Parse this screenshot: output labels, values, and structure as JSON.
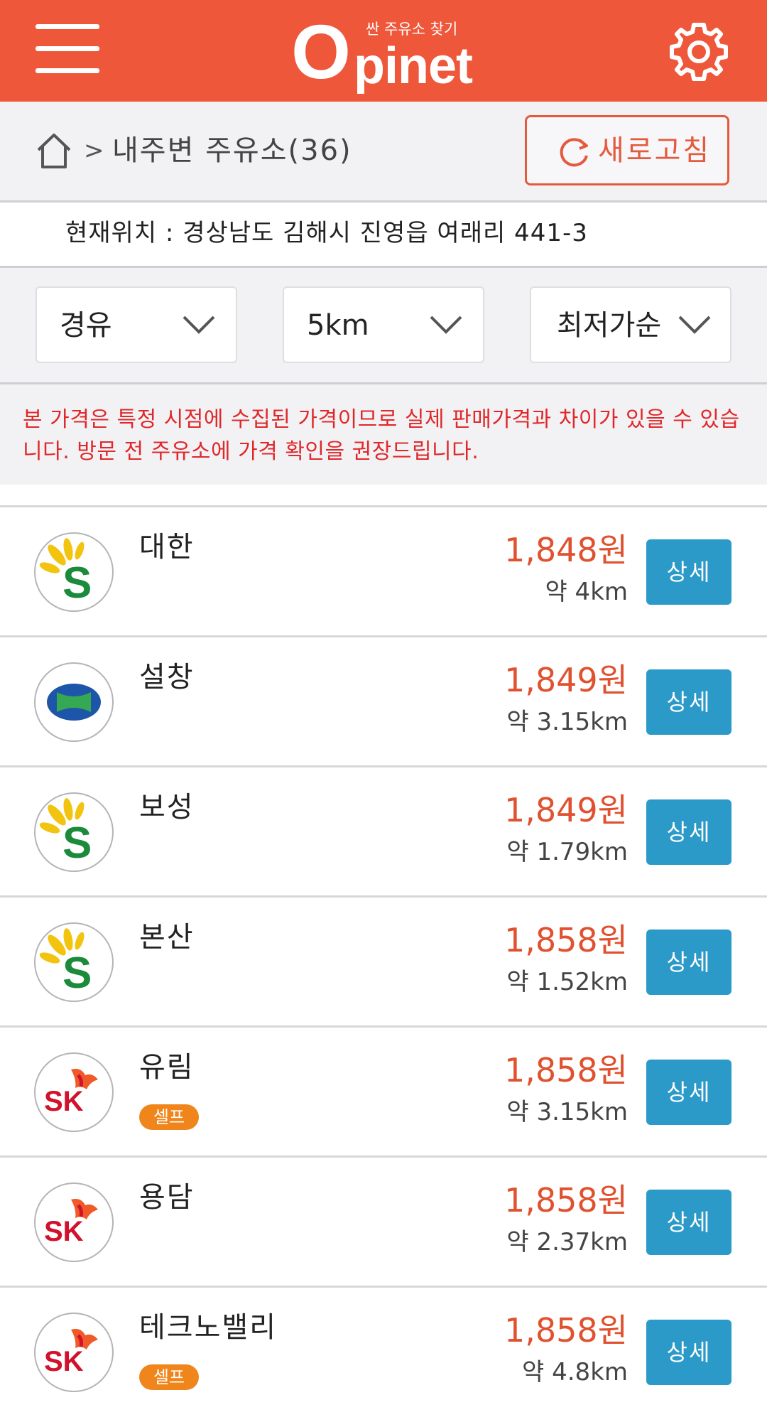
{
  "header": {
    "logo_letter": "O",
    "logo_rest": "pinet",
    "logo_tagline": "싼 주유소 찾기",
    "brand_color": "#ef573a"
  },
  "breadcrumb": {
    "separator": ">",
    "label": "내주변 주유소(36)",
    "refresh_label": "새로고침"
  },
  "location": {
    "text": "현재위치 : 경상남도 김해시 진영읍 여래리 441-3"
  },
  "filters": {
    "fuel": "경유",
    "radius": "5km",
    "sort": "최저가순"
  },
  "notice": {
    "text": "본 가격은 특정 시점에 수집된 가격이므로 실제 판매가격과 차이가 있을 수 있습니다. 방문 전 주유소에 가격 확인을 권장드립니다.",
    "color": "#e0282a"
  },
  "stations": [
    {
      "name": "대한",
      "brand": "s-oil-logo-icon",
      "self": "",
      "price": "1,848원",
      "distance": "약 4km",
      "detail": "상세"
    },
    {
      "name": "설창",
      "brand": "hyundai-oilbank-logo-icon",
      "self": "",
      "price": "1,849원",
      "distance": "약 3.15km",
      "detail": "상세"
    },
    {
      "name": "보성",
      "brand": "s-oil-logo-icon",
      "self": "",
      "price": "1,849원",
      "distance": "약 1.79km",
      "detail": "상세"
    },
    {
      "name": "본산",
      "brand": "s-oil-logo-icon",
      "self": "",
      "price": "1,858원",
      "distance": "약 1.52km",
      "detail": "상세"
    },
    {
      "name": "유림",
      "brand": "sk-logo-icon",
      "self": "셀프",
      "price": "1,858원",
      "distance": "약 3.15km",
      "detail": "상세"
    },
    {
      "name": "용담",
      "brand": "sk-logo-icon",
      "self": "",
      "price": "1,858원",
      "distance": "약 2.37km",
      "detail": "상세"
    },
    {
      "name": "테크노밸리",
      "brand": "sk-logo-icon",
      "self": "셀프",
      "price": "1,858원",
      "distance": "약 4.8km",
      "detail": "상세"
    }
  ],
  "colors": {
    "price": "#e0512f",
    "detail_button": "#2c9ac8",
    "self_badge": "#f0861b"
  }
}
